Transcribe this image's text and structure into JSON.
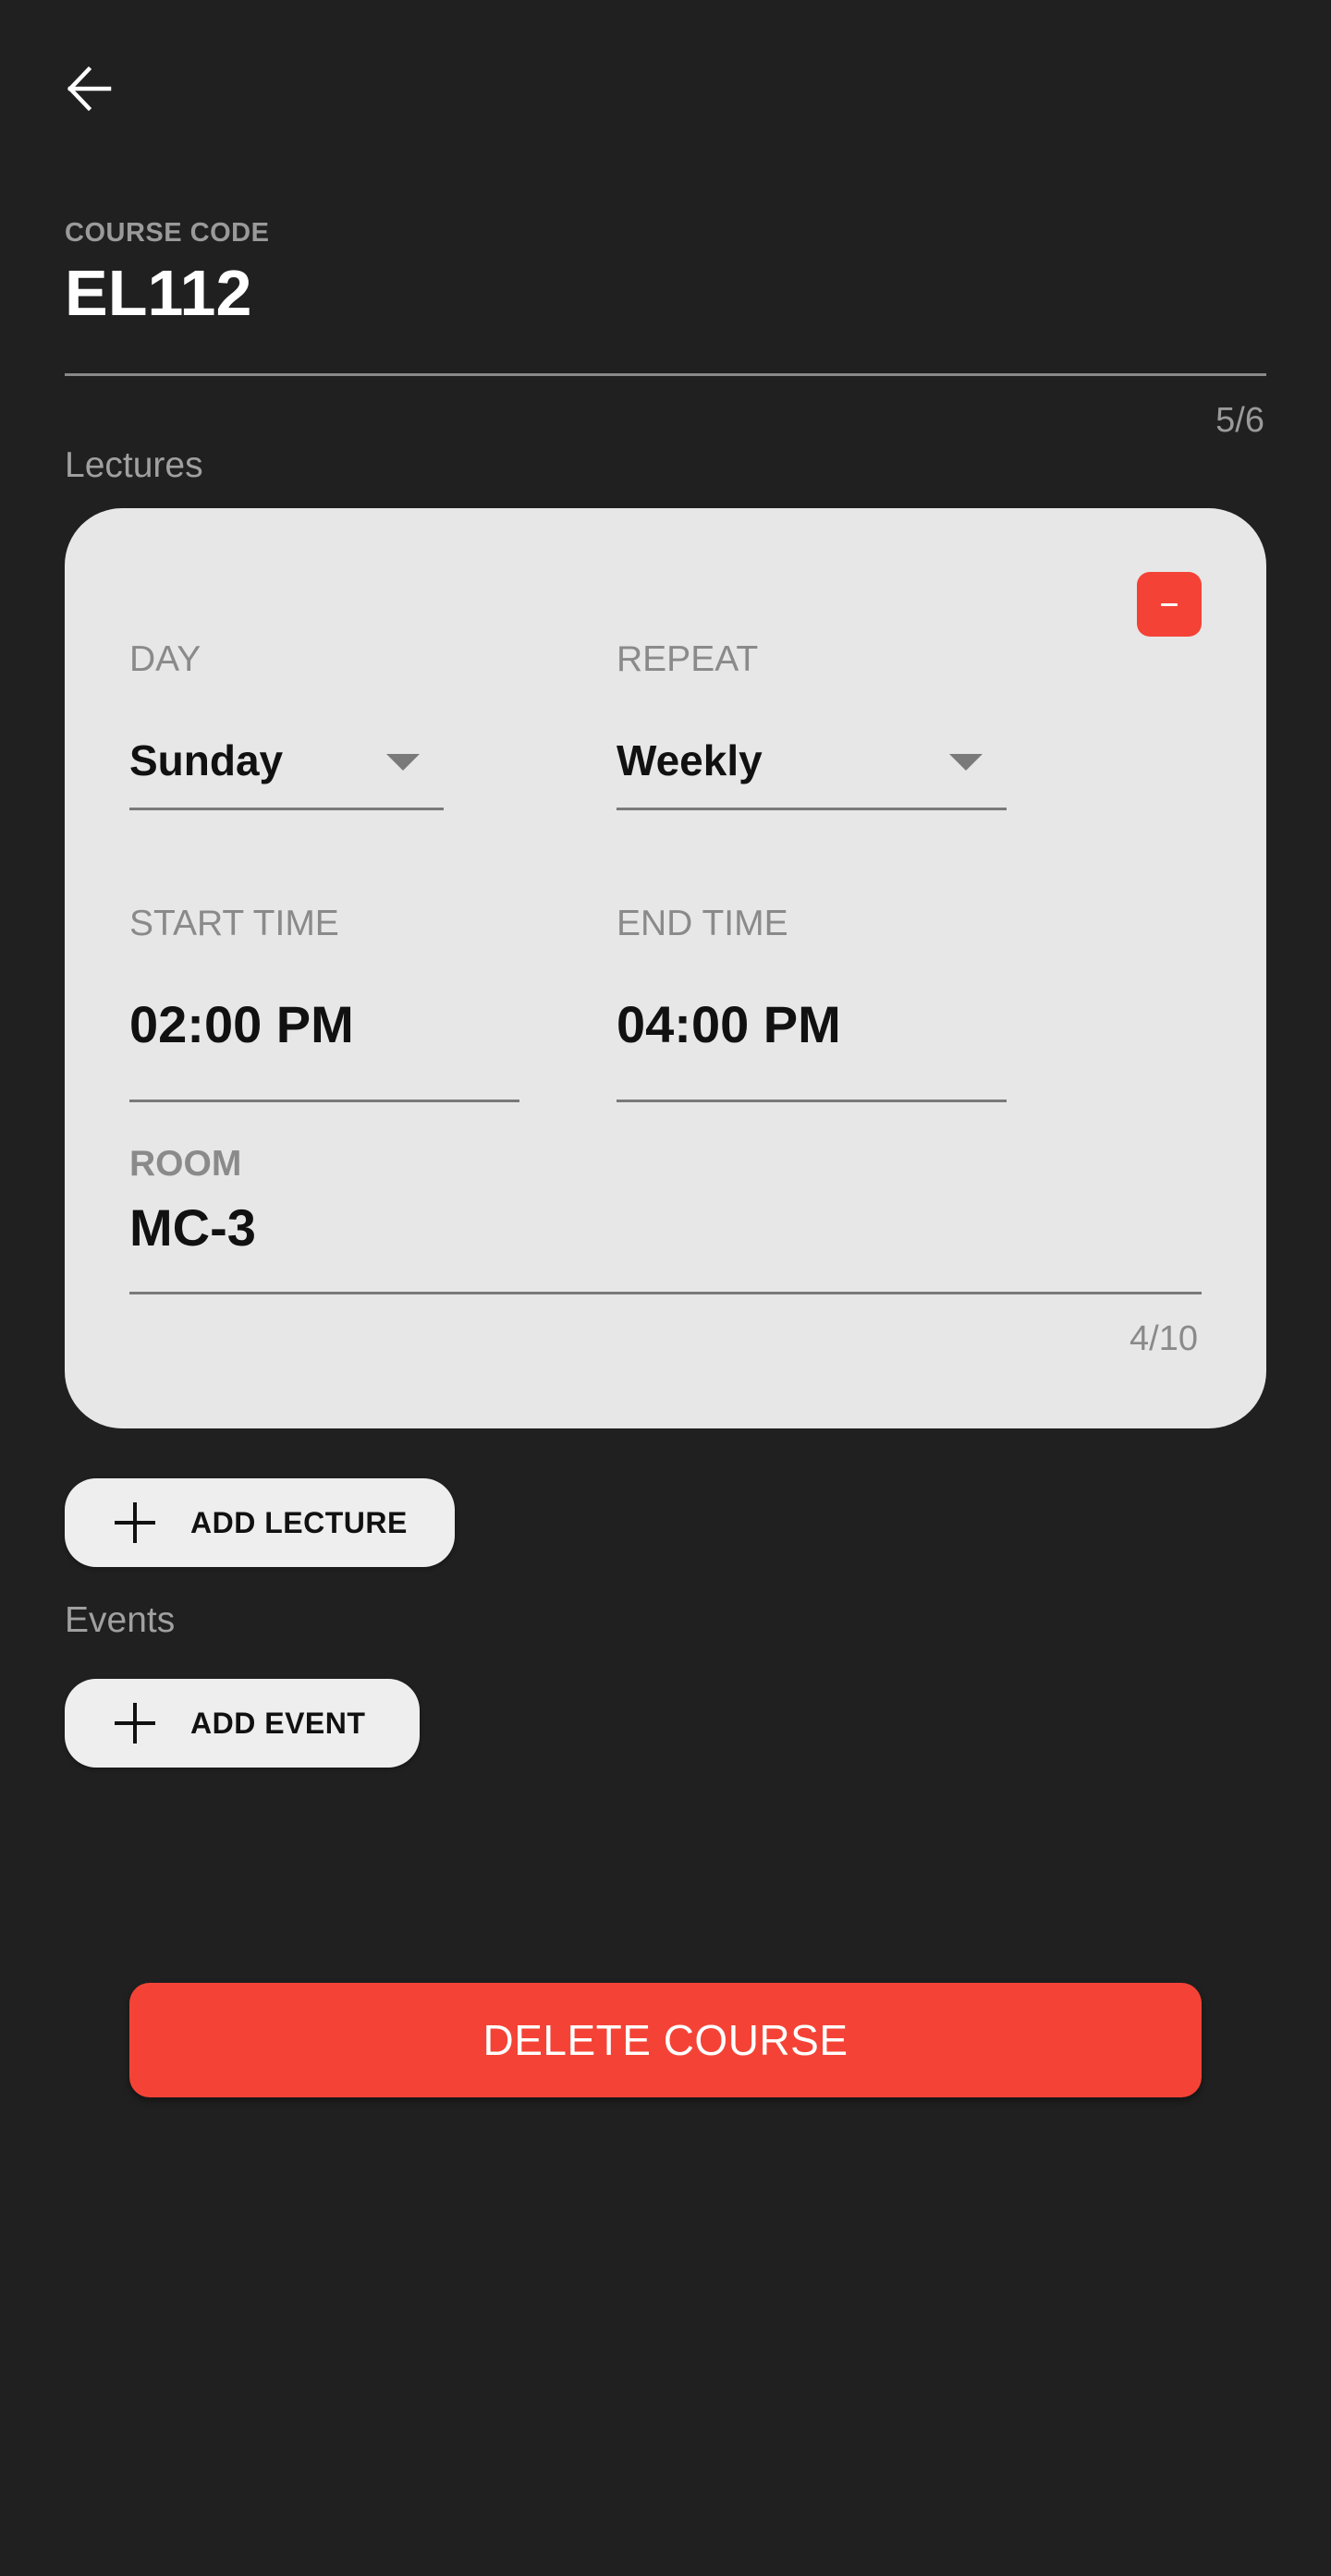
{
  "colors": {
    "background": "#202020",
    "card": "#e7e7e7",
    "accent_red": "#f44336",
    "label_gray": "#9a9a9a"
  },
  "header": {
    "back_icon": "arrow-left-icon"
  },
  "course": {
    "code_label": "COURSE CODE",
    "code_value": "EL112",
    "code_counter": "5/6"
  },
  "lectures": {
    "section_label": "Lectures",
    "items": [
      {
        "remove_icon": "minus-icon",
        "day_label": "DAY",
        "day_value": "Sunday",
        "repeat_label": "REPEAT",
        "repeat_value": "Weekly",
        "start_label": "START TIME",
        "start_value": "02:00 PM",
        "end_label": "END TIME",
        "end_value": "04:00 PM",
        "room_label": "ROOM",
        "room_value": "MC-3",
        "room_counter": "4/10"
      }
    ],
    "add_label": "ADD LECTURE",
    "add_icon": "plus-icon"
  },
  "events": {
    "section_label": "Events",
    "add_label": "ADD EVENT",
    "add_icon": "plus-icon"
  },
  "actions": {
    "delete_label": "DELETE COURSE"
  }
}
